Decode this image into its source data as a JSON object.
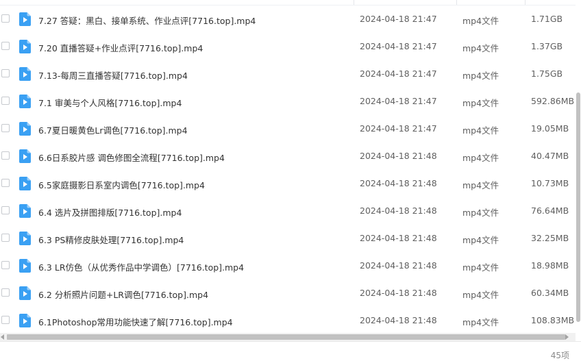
{
  "files": [
    {
      "name": "7.27 答疑：黑白、接单系统、作业点评[7716.top].mp4",
      "date": "2024-04-18 21:47",
      "type": "mp4文件",
      "size": "1.71GB"
    },
    {
      "name": "7.20 直播答疑+作业点评[7716.top].mp4",
      "date": "2024-04-18 21:47",
      "type": "mp4文件",
      "size": "1.37GB"
    },
    {
      "name": "7.13-每周三直播答疑[7716.top].mp4",
      "date": "2024-04-18 21:47",
      "type": "mp4文件",
      "size": "1.75GB"
    },
    {
      "name": "7.1 审美与个人风格[7716.top].mp4",
      "date": "2024-04-18 21:47",
      "type": "mp4文件",
      "size": "592.86MB"
    },
    {
      "name": "6.7夏日暖黄色Lr调色[7716.top].mp4",
      "date": "2024-04-18 21:47",
      "type": "mp4文件",
      "size": "19.05MB"
    },
    {
      "name": "6.6日系胶片感 调色修图全流程[7716.top].mp4",
      "date": "2024-04-18 21:48",
      "type": "mp4文件",
      "size": "40.47MB"
    },
    {
      "name": "6.5家庭摄影日系室内调色[7716.top].mp4",
      "date": "2024-04-18 21:48",
      "type": "mp4文件",
      "size": "10.73MB"
    },
    {
      "name": "6.4 选片及拼图排版[7716.top].mp4",
      "date": "2024-04-18 21:48",
      "type": "mp4文件",
      "size": "76.64MB"
    },
    {
      "name": "6.3 PS精修皮肤处理[7716.top].mp4",
      "date": "2024-04-18 21:48",
      "type": "mp4文件",
      "size": "32.25MB"
    },
    {
      "name": "6.3 LR仿色（从优秀作品中学调色）[7716.top].mp4",
      "date": "2024-04-18 21:48",
      "type": "mp4文件",
      "size": "18.98MB"
    },
    {
      "name": "6.2 分析照片问题+LR调色[7716.top].mp4",
      "date": "2024-04-18 21:48",
      "type": "mp4文件",
      "size": "60.34MB"
    },
    {
      "name": "6.1Photoshop常用功能快速了解[7716.top].mp4",
      "date": "2024-04-18 21:48",
      "type": "mp4文件",
      "size": "108.83MB"
    }
  ],
  "footer": {
    "item_count": "45项"
  },
  "colors": {
    "video_icon": "#3aa0f3",
    "scrollbar_thumb": "#c1c1c1"
  },
  "icons": {
    "file": "video-file-icon"
  }
}
